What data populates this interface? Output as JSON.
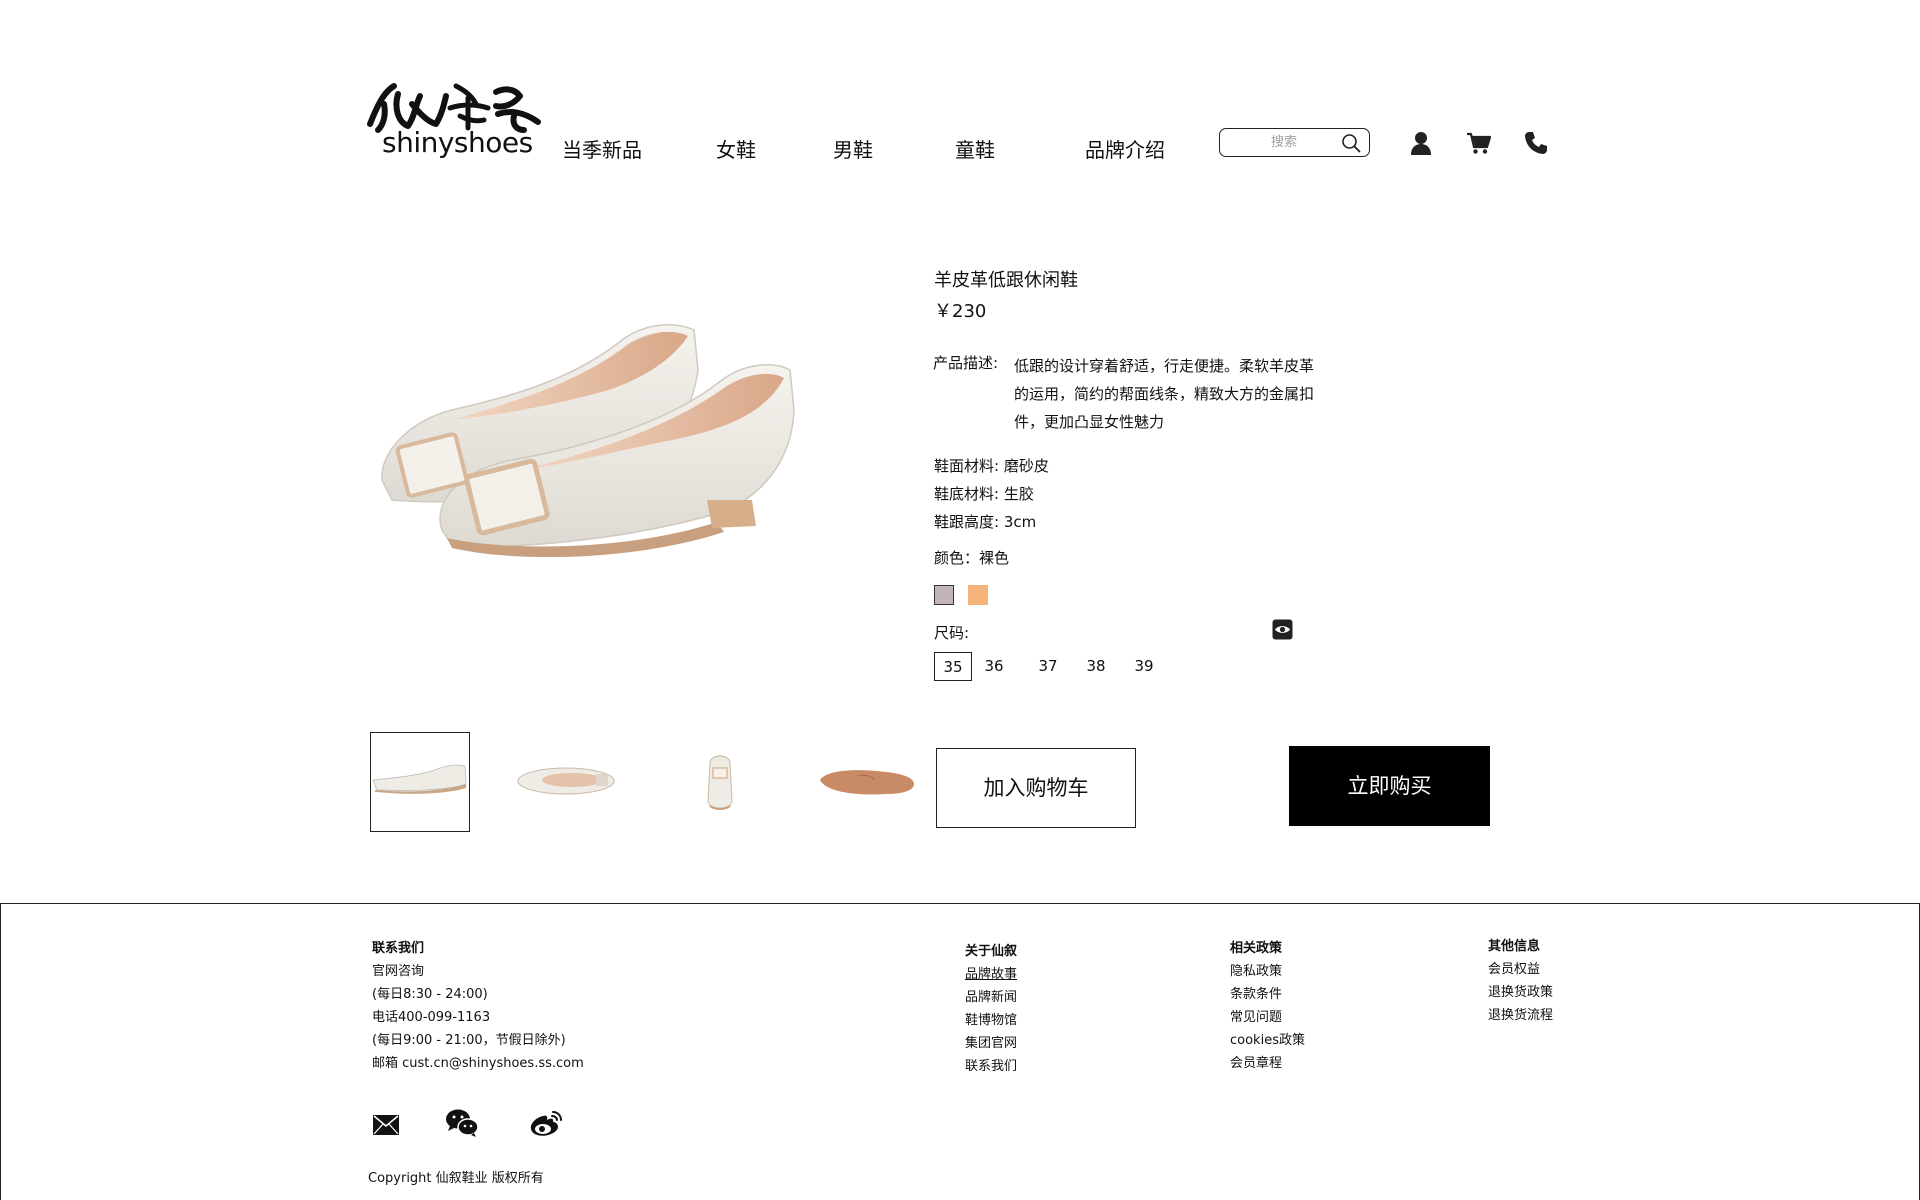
{
  "brand": {
    "logo_text": "shinyshoes"
  },
  "nav": [
    {
      "label": "当季新品"
    },
    {
      "label": "女鞋"
    },
    {
      "label": "男鞋"
    },
    {
      "label": "童鞋"
    },
    {
      "label": "品牌介绍"
    }
  ],
  "search": {
    "placeholder": "搜索"
  },
  "header_icons": [
    "user-icon",
    "cart-icon",
    "phone-icon"
  ],
  "product": {
    "title": "羊皮革低跟休闲鞋",
    "price": "￥230",
    "description_label": "产品描述:",
    "description": "低跟的设计穿着舒适，行走便捷。柔软羊皮革的运用，简约的帮面线条，精致大方的金属扣件，更加凸显女性魅力",
    "specs": [
      {
        "text": "鞋面材料: 磨砂皮"
      },
      {
        "text": "鞋底材料: 生胶"
      },
      {
        "text": "鞋跟高度: 3cm"
      }
    ],
    "color_text": "颜色：裸色",
    "colors": [
      "#c3b4bb",
      "#f5b47a"
    ],
    "size_label": "尺码:",
    "sizes": [
      "35",
      "36",
      "37",
      "38",
      "39"
    ],
    "selected_size": "35"
  },
  "actions": {
    "add_to_cart": "加入购物车",
    "buy_now": "立即购买"
  },
  "footer": {
    "contact": {
      "heading": "联系我们",
      "lines": [
        "官网咨询",
        "(每日8:30 - 24:00)",
        "电话400-099-1163",
        "(每日9:00 - 21:00，节假日除外)",
        "邮箱 cust.cn@shinyshoes.ss.com"
      ]
    },
    "about": {
      "heading": "关于仙叙",
      "links": [
        "品牌故事",
        "品牌新闻",
        "鞋博物馆",
        "集团官网",
        "联系我们"
      ]
    },
    "policy": {
      "heading": "相关政策",
      "links": [
        "隐私政策",
        "条款条件",
        "常见问题",
        "cookies政策",
        "会员章程"
      ]
    },
    "other": {
      "heading": "其他信息",
      "links": [
        "会员权益",
        "退换货政策",
        "退换货流程"
      ]
    },
    "social_icons": [
      "mail-icon",
      "wechat-icon",
      "weibo-icon"
    ],
    "copyright": "Copyright 仙叙鞋业 版权所有"
  }
}
